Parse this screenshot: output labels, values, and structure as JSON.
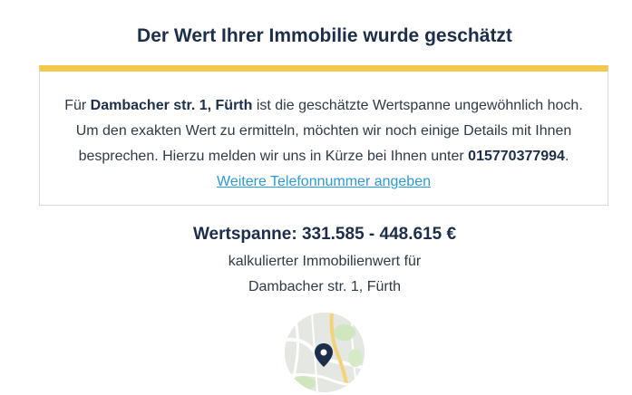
{
  "header": {
    "title": "Der Wert Ihrer Immobilie wurde geschätzt"
  },
  "notice": {
    "line1_prefix": "Für ",
    "address": "Dambacher str. 1, Fürth",
    "line1_suffix": " ist die geschätzte Wertspanne ungewöhnlich hoch.",
    "line2": "Um den exakten Wert zu ermitteln, möchten wir noch einige Details mit Ihnen",
    "line3_prefix": "besprechen. Hierzu melden wir uns in Kürze bei Ihnen unter ",
    "phone": "015770377994",
    "line3_suffix": ".",
    "link_label": "Weitere Telefonnummer angeben",
    "accent_color": "#f2c94c",
    "link_color": "#2a9bd8"
  },
  "result": {
    "range_label": "Wertspanne: 331.585 - 448.615 €",
    "caption": "kalkulierter Immobilienwert für",
    "address": "Dambacher str. 1, Fürth"
  },
  "map": {
    "icon": "location-pin-icon",
    "pin_color": "#1c2e4a"
  }
}
